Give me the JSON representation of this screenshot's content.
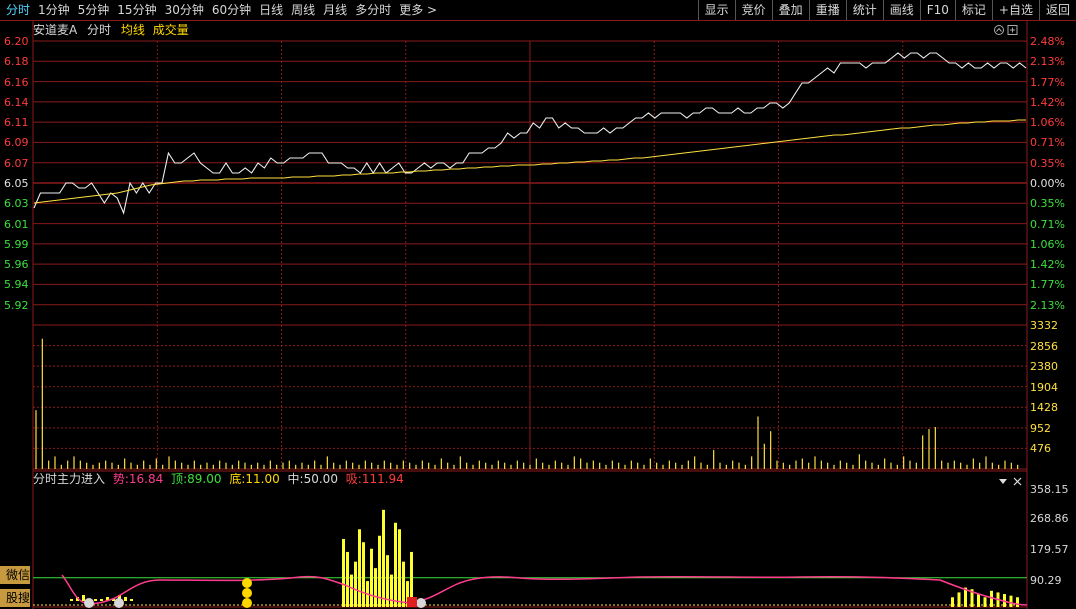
{
  "toolbar": {
    "tabs": [
      "分时",
      "1分钟",
      "5分钟",
      "15分钟",
      "30分钟",
      "60分钟",
      "日线",
      "周线",
      "月线",
      "多分时",
      "更多 >"
    ],
    "active_tab": "分时",
    "right_buttons": [
      "显示",
      "竞价",
      "叠加",
      "重播",
      "统计",
      "画线",
      "F10",
      "标记",
      "+自选",
      "返回"
    ]
  },
  "stock": {
    "name": "安道麦A",
    "mode": "分时",
    "avg_label": "均线",
    "vol_label": "成交量"
  },
  "price_axis": {
    "left_labels": [
      "6.20",
      "6.18",
      "6.16",
      "6.14",
      "6.11",
      "6.09",
      "6.07",
      "6.05",
      "6.03",
      "6.01",
      "5.99",
      "5.96",
      "5.94",
      "5.92"
    ],
    "right_labels": [
      "2.48%",
      "2.13%",
      "1.77%",
      "1.42%",
      "1.06%",
      "0.71%",
      "0.35%",
      "0.00%",
      "0.35%",
      "0.71%",
      "1.06%",
      "1.42%",
      "1.77%",
      "2.13%"
    ],
    "up_color": "#ff3c3c",
    "flat_color": "#e0e0e0",
    "down_color": "#3ce03c"
  },
  "volume_axis": {
    "labels": [
      "3332",
      "2856",
      "2380",
      "1904",
      "1428",
      "952",
      "476"
    ],
    "color": "#ffe040"
  },
  "indicator": {
    "name": "分时主力进入",
    "trend_label": "势:",
    "trend_value": "16.84",
    "top_label": "顶:",
    "top_value": "89.00",
    "bottom_label": "底:",
    "bottom_value": "11.00",
    "mid_label": "中:",
    "mid_value": "50.00",
    "absorb_label": "吸:",
    "absorb_value": "111.94",
    "axis_labels": [
      "358.15",
      "268.86",
      "179.57",
      "90.29"
    ],
    "dropdown_icon": "triangle-down-icon",
    "close_icon": "close-icon"
  },
  "side_buttons": [
    "微信",
    "股搜"
  ],
  "chart_data": {
    "type": "line",
    "price_series": [
      6.035,
      6.05,
      6.05,
      6.05,
      6.05,
      6.06,
      6.06,
      6.055,
      6.055,
      6.06,
      6.05,
      6.04,
      6.05,
      6.045,
      6.03,
      6.06,
      6.05,
      6.06,
      6.05,
      6.06,
      6.06,
      6.09,
      6.08,
      6.08,
      6.085,
      6.09,
      6.08,
      6.075,
      6.07,
      6.07,
      6.08,
      6.07,
      6.07,
      6.075,
      6.07,
      6.08,
      6.075,
      6.085,
      6.08,
      6.08,
      6.085,
      6.085,
      6.085,
      6.09,
      6.09,
      6.09,
      6.08,
      6.08,
      6.08,
      6.075,
      6.075,
      6.07,
      6.08,
      6.07,
      6.08,
      6.07,
      6.075,
      6.08,
      6.07,
      6.07,
      6.075,
      6.08,
      6.075,
      6.08,
      6.08,
      6.075,
      6.08,
      6.08,
      6.09,
      6.09,
      6.09,
      6.095,
      6.095,
      6.1,
      6.11,
      6.105,
      6.11,
      6.11,
      6.12,
      6.115,
      6.125,
      6.125,
      6.115,
      6.12,
      6.115,
      6.115,
      6.11,
      6.11,
      6.11,
      6.115,
      6.11,
      6.115,
      6.115,
      6.12,
      6.125,
      6.125,
      6.13,
      6.125,
      6.13,
      6.13,
      6.13,
      6.13,
      6.125,
      6.13,
      6.13,
      6.135,
      6.135,
      6.13,
      6.13,
      6.13,
      6.135,
      6.13,
      6.13,
      6.135,
      6.135,
      6.14,
      6.14,
      6.135,
      6.14,
      6.15,
      6.16,
      6.16,
      6.165,
      6.17,
      6.175,
      6.17,
      6.18,
      6.18,
      6.18,
      6.18,
      6.175,
      6.18,
      6.18,
      6.18,
      6.185,
      6.19,
      6.185,
      6.19,
      6.19,
      6.185,
      6.19,
      6.19,
      6.185,
      6.18,
      6.18,
      6.175,
      6.18,
      6.175,
      6.175,
      6.18,
      6.175,
      6.18,
      6.18,
      6.175,
      6.18,
      6.175
    ],
    "avg_series": [
      6.04,
      6.041,
      6.042,
      6.043,
      6.044,
      6.045,
      6.046,
      6.047,
      6.048,
      6.049,
      6.05,
      6.052,
      6.054,
      6.056,
      6.058,
      6.059,
      6.06,
      6.061,
      6.062,
      6.062,
      6.063,
      6.063,
      6.063,
      6.064,
      6.064,
      6.064,
      6.065,
      6.065,
      6.065,
      6.065,
      6.065,
      6.066,
      6.066,
      6.066,
      6.067,
      6.067,
      6.067,
      6.068,
      6.068,
      6.069,
      6.069,
      6.07,
      6.07,
      6.07,
      6.071,
      6.071,
      6.072,
      6.072,
      6.073,
      6.073,
      6.074,
      6.074,
      6.075,
      6.075,
      6.076,
      6.076,
      6.077,
      6.077,
      6.078,
      6.078,
      6.078,
      6.079,
      6.079,
      6.08,
      6.08,
      6.081,
      6.081,
      6.082,
      6.082,
      6.083,
      6.083,
      6.084,
      6.085,
      6.085,
      6.086,
      6.087,
      6.088,
      6.089,
      6.09,
      6.091,
      6.092,
      6.093,
      6.094,
      6.095,
      6.096,
      6.097,
      6.098,
      6.099,
      6.1,
      6.101,
      6.102,
      6.103,
      6.104,
      6.105,
      6.106,
      6.107,
      6.108,
      6.108,
      6.109,
      6.11,
      6.111,
      6.112,
      6.113,
      6.114,
      6.115,
      6.115,
      6.116,
      6.117,
      6.118,
      6.118,
      6.119,
      6.12,
      6.12,
      6.121,
      6.121,
      6.122,
      6.122,
      6.122,
      6.123,
      6.123
    ],
    "volume_series": [
      1400,
      3100,
      200,
      300,
      100,
      200,
      300,
      200,
      150,
      100,
      150,
      200,
      150,
      100,
      250,
      150,
      100,
      200,
      100,
      250,
      100,
      300,
      200,
      150,
      100,
      200,
      100,
      150,
      100,
      200,
      150,
      100,
      200,
      150,
      100,
      150,
      100,
      200,
      100,
      150,
      200,
      100,
      150,
      100,
      200,
      100,
      300,
      150,
      100,
      200,
      150,
      100,
      200,
      150,
      100,
      200,
      150,
      100,
      200,
      150,
      100,
      200,
      150,
      100,
      250,
      150,
      100,
      300,
      150,
      100,
      200,
      150,
      100,
      200,
      150,
      100,
      200,
      150,
      100,
      250,
      150,
      100,
      200,
      150,
      100,
      300,
      250,
      150,
      200,
      150,
      100,
      200,
      150,
      100,
      200,
      150,
      100,
      250,
      150,
      100,
      200,
      150,
      100,
      200,
      300,
      150,
      100,
      450,
      150,
      100,
      200,
      150,
      100,
      300,
      1250,
      600,
      900,
      200,
      150,
      100,
      200,
      250,
      150,
      300,
      200,
      150,
      100,
      200,
      150,
      100,
      350,
      200,
      150,
      100,
      250,
      150,
      100,
      300,
      200,
      150,
      800,
      950,
      1000,
      200,
      150,
      200,
      150,
      100,
      250,
      150,
      300,
      150,
      100,
      200,
      150,
      100
    ],
    "indicator_bars": {
      "range_a": [
        0,
        1,
        2,
        0,
        0,
        0,
        1,
        0,
        2,
        1,
        0
      ],
      "spike_values": [
        210,
        170,
        100,
        140,
        240,
        200,
        80,
        180,
        120,
        220,
        300,
        160,
        100,
        260,
        240,
        140,
        80,
        170
      ],
      "tail_values": [
        30,
        45,
        60,
        55,
        40,
        30,
        50,
        45,
        40,
        35,
        30
      ]
    },
    "title": "",
    "xlabel": "",
    "ylabel": "",
    "ylim": [
      5.918,
      6.202
    ]
  }
}
